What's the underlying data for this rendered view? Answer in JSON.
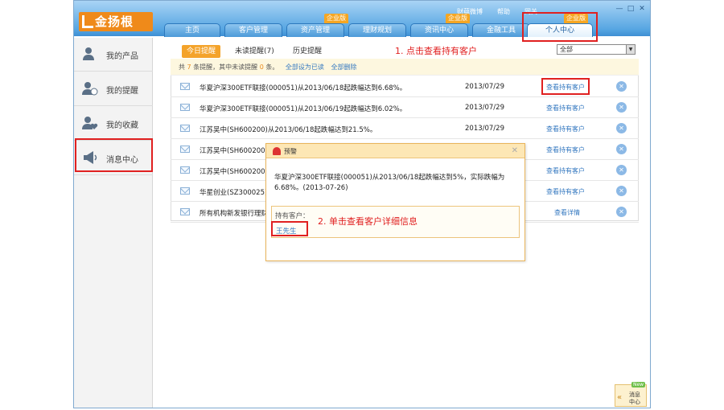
{
  "app": {
    "logo": "金扬根"
  },
  "nav": {
    "tabs": [
      {
        "label": "主页",
        "badge": ""
      },
      {
        "label": "客户管理",
        "badge": ""
      },
      {
        "label": "资产管理",
        "badge": "企业版"
      },
      {
        "label": "理财规划",
        "badge": ""
      },
      {
        "label": "资讯中心",
        "badge": ""
      },
      {
        "label": "金融工具",
        "badge": "企业版"
      },
      {
        "label": "个人中心",
        "badge": "企业版"
      }
    ]
  },
  "toplinks": {
    "weibo": "财蕴微博",
    "link2": "帮助",
    "link3": "网关"
  },
  "sidebar": {
    "items": [
      {
        "label": "我的产品"
      },
      {
        "label": "我的提醒"
      },
      {
        "label": "我的收藏"
      },
      {
        "label": "消息中心"
      }
    ]
  },
  "subtabs": [
    {
      "label": "今日提醒"
    },
    {
      "label": "未读提醒(7)"
    },
    {
      "label": "历史提醒"
    }
  ],
  "filter": {
    "value": "全部"
  },
  "summary": {
    "prefix": "共",
    "total": "7",
    "mid": "条提醒，其中未读提醒",
    "unread": "0",
    "suffix": "条。",
    "mark_all": "全部设为已读",
    "delete_all": "全部删除"
  },
  "rows": [
    {
      "text": "华夏沪深300ETF联接(000051)从2013/06/18起跌幅达到6.68%。",
      "date": "2013/07/29",
      "action": "查看持有客户"
    },
    {
      "text": "华夏沪深300ETF联接(000051)从2013/06/19起跌幅达到6.02%。",
      "date": "2013/07/29",
      "action": "查看持有客户"
    },
    {
      "text": "江苏吴中(SH600200)从2013/06/18起跌幅达到21.5%。",
      "date": "2013/07/29",
      "action": "查看持有客户"
    },
    {
      "text": "江苏吴中(SH600200)",
      "date": "",
      "action": "查看持有客户"
    },
    {
      "text": "江苏吴中(SH600200)",
      "date": "",
      "action": "查看持有客户"
    },
    {
      "text": "华星创业(SZ300025)从",
      "date": "",
      "action": "查看持有客户"
    },
    {
      "text": "所有机构新发银行理财",
      "date": "",
      "action": "查看详情"
    }
  ],
  "dialog": {
    "title": "预警",
    "message": "华夏沪深300ETF联接(000051)从2013/06/18起跌幅达到5%，实际跌幅为6.68%。(2013-07-26)",
    "holders_label": "持有客户：",
    "customer": "王先生"
  },
  "annotations": {
    "step1": "1. 点击查看持有客户",
    "step2": "2. 单击查看客户详细信息"
  },
  "msgcenter": {
    "new": "New",
    "label": "消息中心"
  }
}
